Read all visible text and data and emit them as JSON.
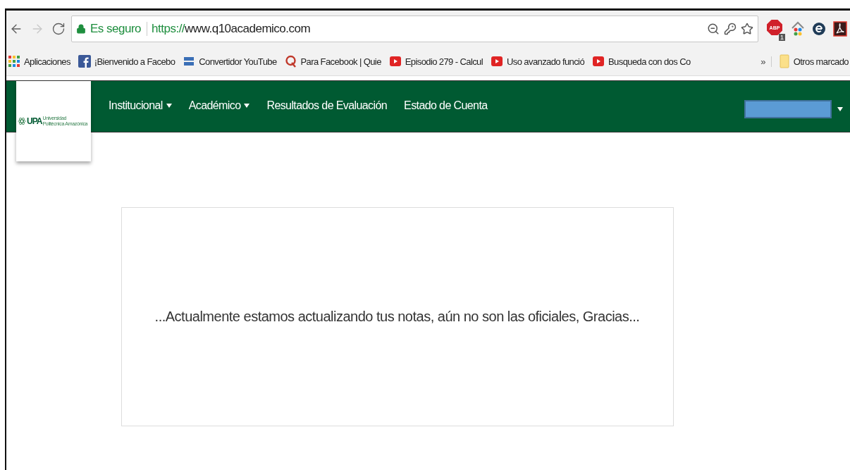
{
  "browser": {
    "nav_buttons": [
      {
        "kind": "back",
        "disabled": false
      },
      {
        "kind": "forward",
        "disabled": true
      },
      {
        "kind": "reload",
        "disabled": false
      }
    ],
    "security_label": "Es seguro",
    "url_scheme": "https://",
    "url_rest": "www.q10academico.com",
    "extensions": [
      {
        "kind": "abp",
        "label": "ABP",
        "badge": "1"
      },
      {
        "kind": "home"
      },
      {
        "kind": "e"
      },
      {
        "kind": "pdf"
      }
    ]
  },
  "bookmarks": [
    {
      "kind": "apps",
      "label": "Aplicaciones"
    },
    {
      "kind": "facebook",
      "label": "¡Bienvenido a Facebo"
    },
    {
      "kind": "ytmp3",
      "label": "Convertidor YouTube"
    },
    {
      "kind": "quora",
      "label": "Para Facebook | Quie"
    },
    {
      "kind": "youtube",
      "label": "Episodio 279 - Calcul"
    },
    {
      "kind": "youtube",
      "label": "Uso avanzado funció"
    },
    {
      "kind": "youtube",
      "label": "Busqueda con dos Co"
    }
  ],
  "bookmarks_more": "»",
  "other_bookmarks": "Otros marcado",
  "site": {
    "logo": {
      "acronym": "UPA",
      "line_1": "Universidad",
      "line_2": "Politécnica Amazónica"
    },
    "menu": [
      {
        "label": "Institucional",
        "dropdown": true
      },
      {
        "label": "Académico",
        "dropdown": true
      },
      {
        "label": "Resultados de Evaluación",
        "dropdown": false
      },
      {
        "label": "Estado de Cuenta",
        "dropdown": false
      }
    ],
    "notice": "...Actualmente estamos actualizando tus notas, aún no son las oficiales, Gracias..."
  }
}
